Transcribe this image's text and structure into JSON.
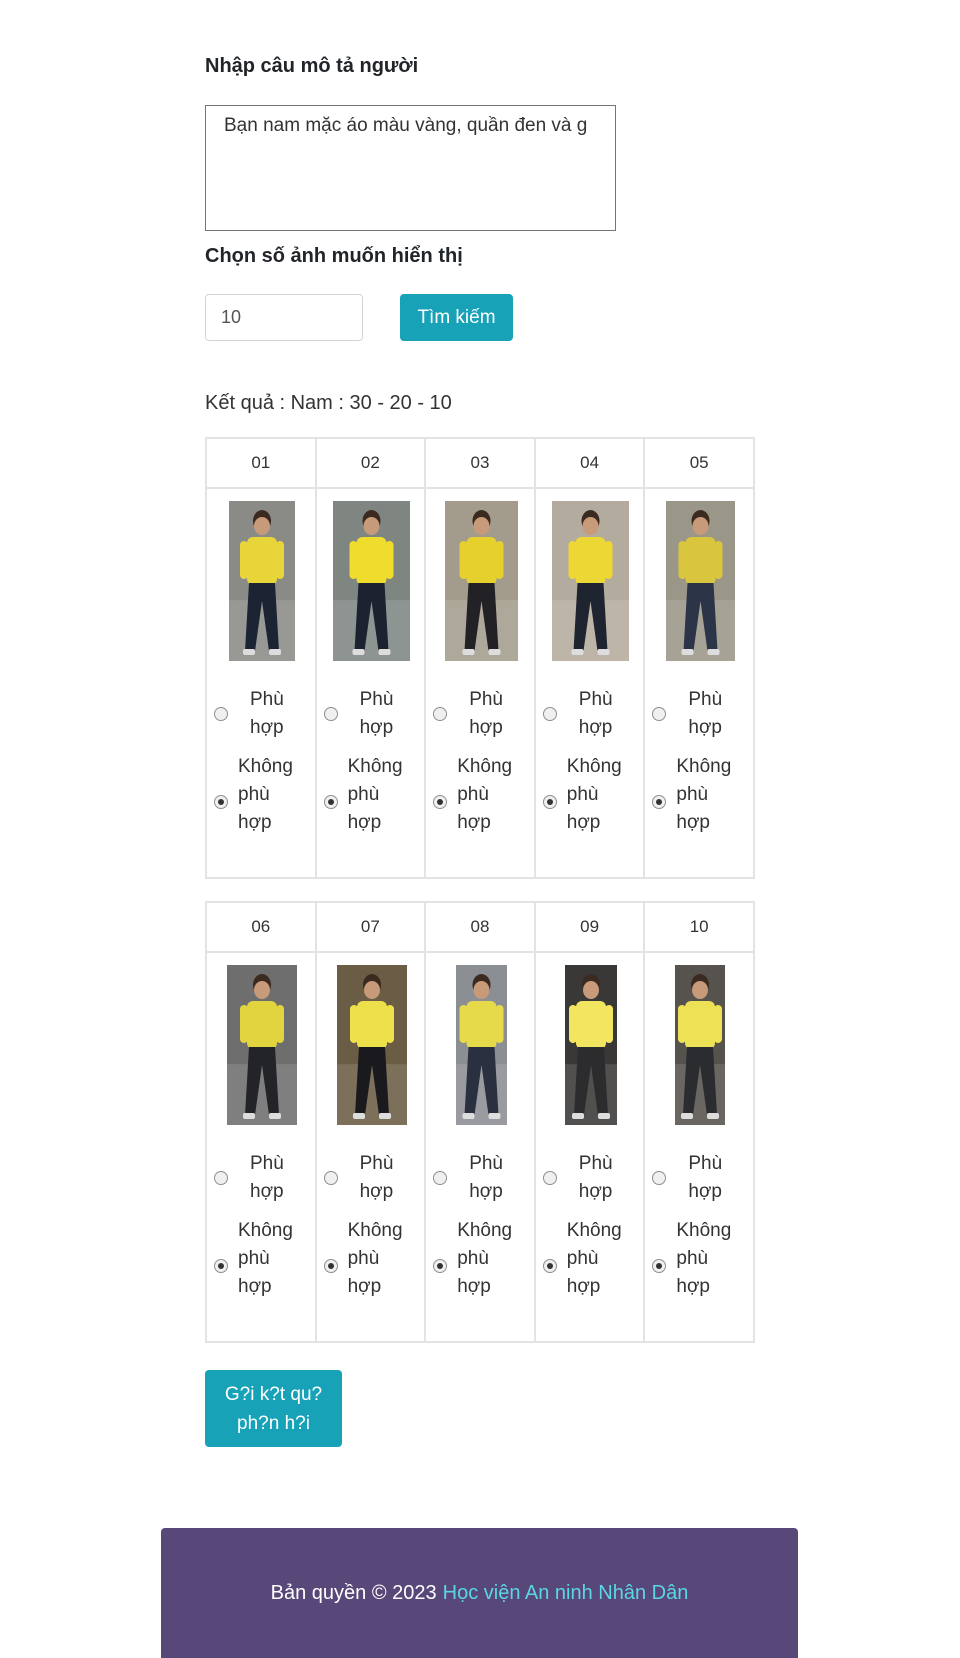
{
  "form": {
    "desc_heading": "Nhập câu mô tả người",
    "desc_value": "Bạn nam mặc áo màu vàng, quần đen và g",
    "count_heading": "Chọn số ảnh muốn hiển thị",
    "count_value": "10",
    "search_label": "Tìm kiếm"
  },
  "result_text": "Kết quả : Nam : 30 - 20 - 10",
  "options": {
    "match": "Phù hợp",
    "no_match_line1": "Không",
    "no_match_line2": "phù hợp"
  },
  "rows": [
    [
      {
        "id": "01",
        "selected": "no_match",
        "shirt": "#e8d53a",
        "pants": "#1c2433",
        "bg": "#8a8a86"
      },
      {
        "id": "02",
        "selected": "no_match",
        "shirt": "#f0dc2c",
        "pants": "#1d2230",
        "bg": "#7f8682"
      },
      {
        "id": "03",
        "selected": "no_match",
        "shirt": "#e5d02e",
        "pants": "#222226",
        "bg": "#a39c8c"
      },
      {
        "id": "04",
        "selected": "no_match",
        "shirt": "#ecd735",
        "pants": "#1e2430",
        "bg": "#b3ab9d"
      },
      {
        "id": "05",
        "selected": "no_match",
        "shirt": "#d9c63e",
        "pants": "#2c3448",
        "bg": "#9a9688"
      }
    ],
    [
      {
        "id": "06",
        "selected": "no_match",
        "shirt": "#e1d43e",
        "pants": "#222428",
        "bg": "#6e6e6e"
      },
      {
        "id": "07",
        "selected": "no_match",
        "shirt": "#ede04a",
        "pants": "#1a1a1e",
        "bg": "#6b5d45"
      },
      {
        "id": "08",
        "selected": "no_match",
        "shirt": "#e7da4a",
        "pants": "#2a3040",
        "bg": "#8b8e93"
      },
      {
        "id": "09",
        "selected": "no_match",
        "shirt": "#f2e660",
        "pants": "#2c2c2e",
        "bg": "#3a3836"
      },
      {
        "id": "10",
        "selected": "no_match",
        "shirt": "#ede155",
        "pants": "#2a2c30",
        "bg": "#56524e"
      }
    ]
  ],
  "send_label_line1": "G?i k?t qu?",
  "send_label_line2": "ph?n h?i",
  "footer": {
    "text": "Bản quyền © 2023",
    "link": "Học viện An ninh Nhân Dân"
  }
}
